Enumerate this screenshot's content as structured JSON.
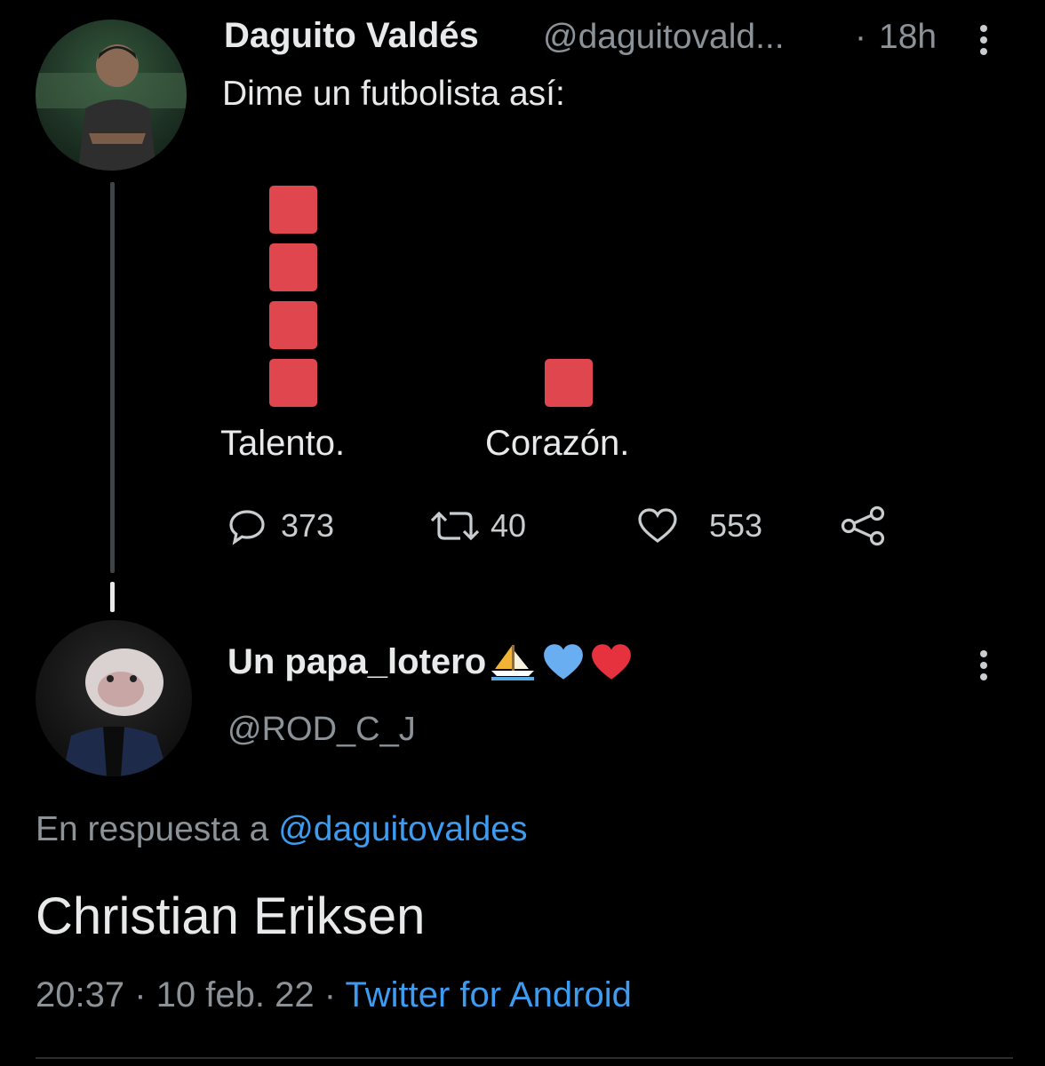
{
  "tweet": {
    "author_name": "Daguito Valdés",
    "author_handle": "@daguitovald...",
    "separator": "·",
    "time": "18h",
    "text": "Dime un futbolista así:",
    "actions": {
      "replies": "373",
      "retweets": "40",
      "likes": "553"
    }
  },
  "chart_data": {
    "type": "bar",
    "categories": [
      "Talento.",
      "Corazón."
    ],
    "values": [
      4,
      1
    ],
    "color": "#e0464e"
  },
  "reply": {
    "author_name": "Un papa_lotero",
    "author_handle": "@ROD_C_J",
    "in_reply_prefix": "En respuesta a",
    "in_reply_mention": "@daguitovaldes",
    "text": "Christian Eriksen",
    "time": "20:37",
    "date": "10 feb. 22",
    "separator": "·",
    "source": "Twitter for Android"
  },
  "icons": {
    "reply": "comment-icon",
    "retweet": "retweet-icon",
    "like": "heart-icon",
    "share": "share-icon",
    "more": "more-vertical-icon",
    "emoji_sailboat": "sailboat-emoji",
    "emoji_blue_heart": "blue-heart-emoji",
    "emoji_red_heart": "red-heart-emoji"
  },
  "colors": {
    "background": "#000000",
    "link": "#3d9bf0",
    "muted": "#8b9298",
    "bar": "#e0464e"
  }
}
